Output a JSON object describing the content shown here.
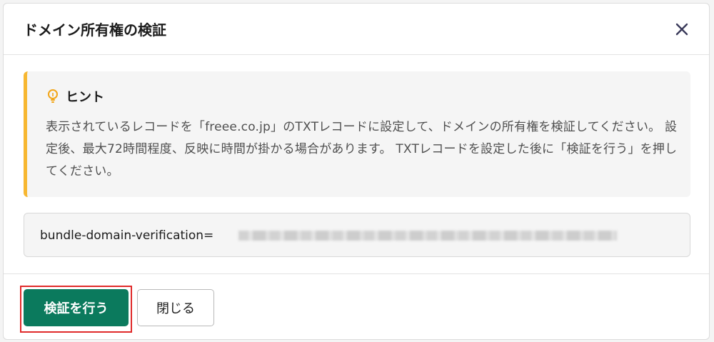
{
  "dialog": {
    "title": "ドメイン所有権の検証",
    "close_icon": "close-icon"
  },
  "hint": {
    "icon": "lightbulb-icon",
    "title": "ヒント",
    "body": "表示されているレコードを「freee.co.jp」のTXTレコードに設定して、ドメインの所有権を検証してください。 設定後、最大72時間程度、反映に時間が掛かる場合があります。 TXTレコードを設定した後に「検証を行う」を押してください。",
    "accent_color": "#f7b731"
  },
  "record": {
    "prefix": "bundle-domain-verification="
  },
  "footer": {
    "verify_label": "検証を行う",
    "close_label": "閉じる",
    "primary_color": "#0b7a5d",
    "highlight_color": "#e02a2a"
  }
}
